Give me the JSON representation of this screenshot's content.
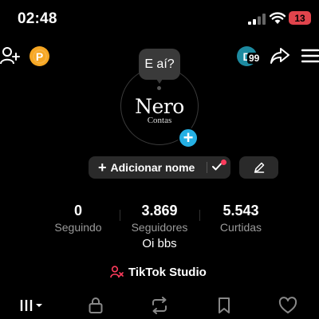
{
  "status_bar": {
    "time": "02:48",
    "battery": "13"
  },
  "header": {
    "coin_label": "P",
    "avatar_badge_letter": "D",
    "avatar_badge_count": "99"
  },
  "profile": {
    "bubble_text": "E aí?",
    "avatar_name": "Nero",
    "avatar_sub": "Contas",
    "add_name_label": "Adicionar nome",
    "bio": "Oi bbs",
    "studio_label": "TikTok Studio"
  },
  "stats": [
    {
      "value": "0",
      "label": "Seguindo"
    },
    {
      "value": "3.869",
      "label": "Seguidores"
    },
    {
      "value": "5.543",
      "label": "Curtidas"
    }
  ],
  "colors": {
    "accent_blue": "#25b0e4",
    "coin_orange": "#f6a622",
    "battery_red": "#e0444c",
    "studio_red": "#ff3b5c"
  },
  "tabs": [
    "grid-icon",
    "lock-icon",
    "repost-icon",
    "bookmark-icon",
    "heart-icon"
  ]
}
